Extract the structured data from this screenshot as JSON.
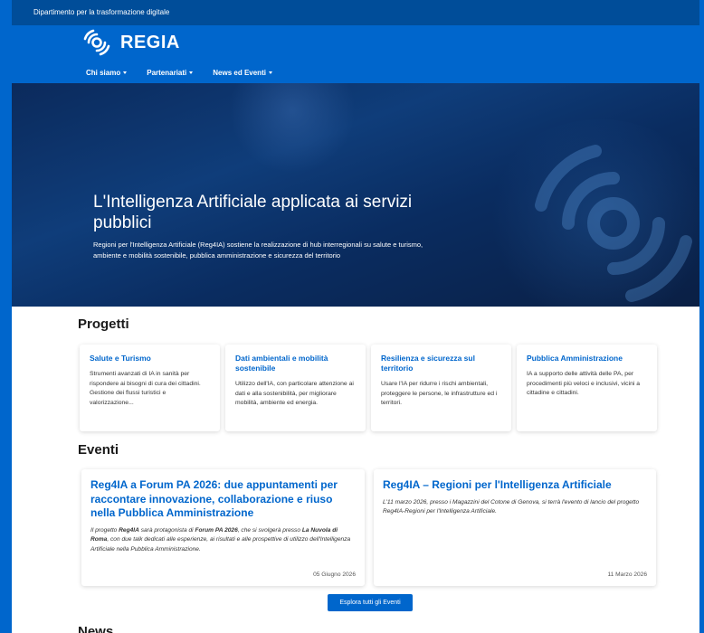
{
  "topbar": {
    "label": "Dipartimento per la trasformazione digitale"
  },
  "brand": {
    "logo_text": "REGIA"
  },
  "nav": {
    "items": [
      {
        "label": "Chi siamo"
      },
      {
        "label": "Partenariati"
      },
      {
        "label": "News ed Eventi"
      }
    ]
  },
  "hero": {
    "title": "L'Intelligenza Artificiale applicata ai servizi pubblici",
    "subtitle": "Regioni per l'Intelligenza Artificiale (Reg4IA) sostiene la realizzazione di hub interregionali su salute e turismo, ambiente e mobilità sostenibile, pubblica amministrazione e sicurezza del territorio"
  },
  "projects": {
    "title": "Progetti",
    "cards": [
      {
        "title": "Salute e Turismo",
        "text": "Strumenti avanzati di IA in sanità per rispondere ai bisogni di cura dei cittadini. Gestione dei flussi turistici e valorizzazione..."
      },
      {
        "title": "Dati ambientali e mobilità sostenibile",
        "text": "Utilizzo dell'IA, con particolare attenzione ai dati e alla sostenibilità, per migliorare mobilità, ambiente ed energia."
      },
      {
        "title": "Resilienza e sicurezza sul territorio",
        "text": "Usare l'IA per ridurre i rischi ambientali, proteggere le persone, le infrastrutture ed i territori."
      },
      {
        "title": "Pubblica Amministrazione",
        "text": "IA a supporto delle attività delle PA, per procedimenti più veloci e inclusivi, vicini a cittadine e cittadini."
      }
    ]
  },
  "events": {
    "title": "Eventi",
    "cards": [
      {
        "title": "Reg4IA a Forum PA 2026: due appuntamenti per raccontare innovazione, collaborazione e riuso nella Pubblica Amministrazione",
        "text_parts": [
          "Il progetto ",
          "Reg4IA",
          " sarà protagonista di ",
          "Forum PA 2026",
          ", che si svolgerà presso ",
          "La Nuvola di Roma",
          ", con due talk dedicati alle esperienze, ai risultati e alle prospettive di utilizzo dell'Intelligenza Artificiale nella Pubblica Amministrazione."
        ],
        "date": "05 Giugno 2026"
      },
      {
        "title": "Reg4IA – Regioni per l'Intelligenza Artificiale",
        "text": "L'11 marzo 2026, presso i Magazzini del Cotone di Genova, si terrà l'evento di lancio del progetto Reg4IA-Regioni per l'Intelligenza Artificiale.",
        "date": "11 Marzo 2026"
      }
    ],
    "cta_label": "Esplora tutti gli Eventi"
  },
  "news": {
    "title": "News"
  },
  "colors": {
    "primary": "#0066cc",
    "topbar": "#004d99",
    "hero_dark": "#0a1f44"
  }
}
